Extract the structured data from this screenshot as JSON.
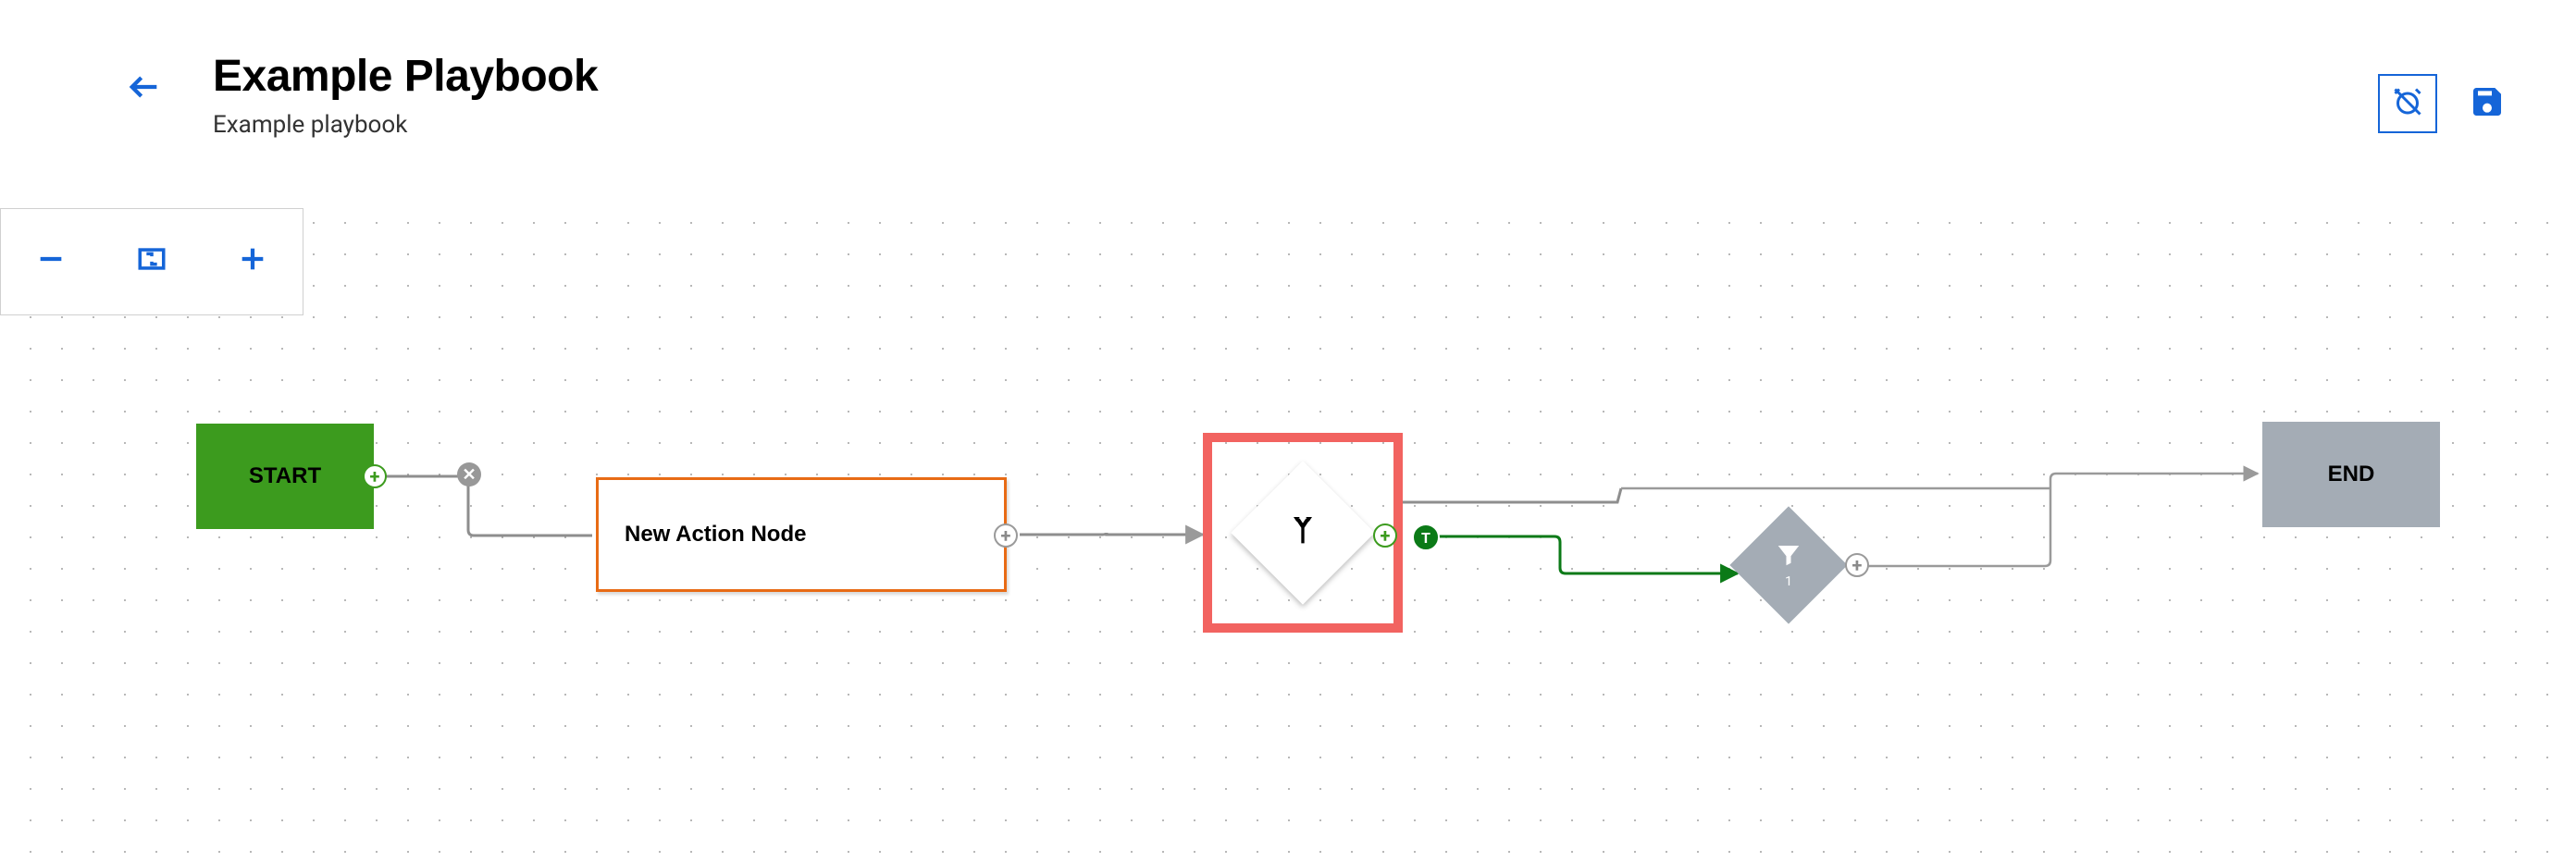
{
  "header": {
    "title": "Example Playbook",
    "subtitle": "Example playbook"
  },
  "nodes": {
    "start": {
      "label": "START"
    },
    "action": {
      "label": "New Action Node"
    },
    "condition": {
      "true_label": "T"
    },
    "filter": {
      "count": "1"
    },
    "end": {
      "label": "END"
    }
  }
}
